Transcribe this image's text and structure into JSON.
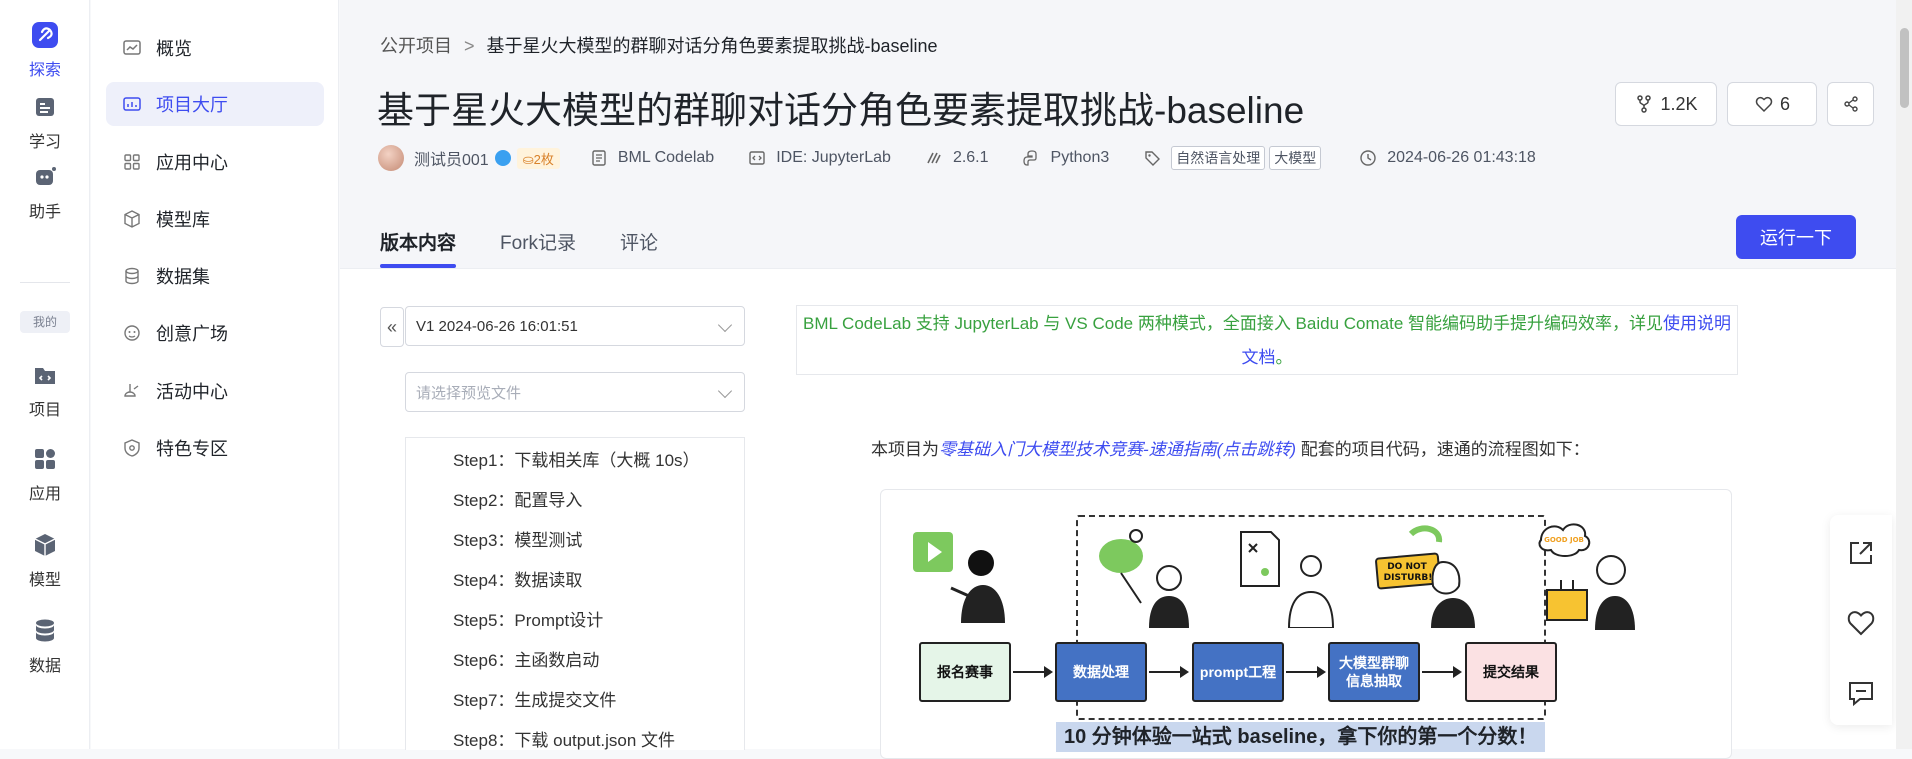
{
  "rail": {
    "items": [
      {
        "label": "探索",
        "icon": "explore-icon",
        "active": true
      },
      {
        "label": "学习",
        "icon": "learn-icon"
      },
      {
        "label": "助手",
        "icon": "assistant-icon"
      },
      {
        "label": "项目",
        "icon": "project-icon"
      },
      {
        "label": "应用",
        "icon": "app-icon"
      },
      {
        "label": "模型",
        "icon": "model-icon"
      },
      {
        "label": "数据",
        "icon": "data-icon"
      }
    ],
    "mine_label": "我的"
  },
  "sidebar": {
    "items": [
      {
        "label": "概览",
        "icon": "overview-icon"
      },
      {
        "label": "项目大厅",
        "icon": "project-hall-icon",
        "active": true
      },
      {
        "label": "应用中心",
        "icon": "app-center-icon"
      },
      {
        "label": "模型库",
        "icon": "model-library-icon"
      },
      {
        "label": "数据集",
        "icon": "dataset-icon"
      },
      {
        "label": "创意广场",
        "icon": "creative-icon"
      },
      {
        "label": "活动中心",
        "icon": "activity-icon"
      },
      {
        "label": "特色专区",
        "icon": "feature-icon"
      }
    ]
  },
  "breadcrumb": {
    "parent": "公开项目",
    "separator": ">",
    "current": "基于星火大模型的群聊对话分角色要素提取挑战-baseline"
  },
  "project": {
    "title": "基于星火大模型的群聊对话分角色要素提取挑战-baseline",
    "author": "测试员001",
    "coins": "2枚",
    "platform": "BML Codelab",
    "ide": "IDE: JupyterLab",
    "version": "2.6.1",
    "language": "Python3",
    "tags": [
      "自然语言处理",
      "大模型"
    ],
    "datetime": "2024-06-26 01:43:18"
  },
  "actions": {
    "fork_count": "1.2K",
    "like_count": "6"
  },
  "tabs": [
    {
      "label": "版本内容",
      "active": true
    },
    {
      "label": "Fork记录"
    },
    {
      "label": "评论"
    }
  ],
  "run_button": "运行一下",
  "version_select": "V1 2024-06-26 16:01:51",
  "preview_select_placeholder": "请选择预览文件",
  "toc": [
    "Step1：下载相关库（大概 10s）",
    "Step2：配置导入",
    "Step3：模型测试",
    "Step4：数据读取",
    "Step5：Prompt设计",
    "Step6：主函数启动",
    "Step7：生成提交文件",
    "Step8：下载 output.json 文件"
  ],
  "notice": {
    "text": "BML CodeLab 支持 JupyterLab 与 VS Code 两种模式，全面接入 Baidu Comate 智能编码助手提升编码效率，详见",
    "link1": "使用说明",
    "link2": "文档",
    "end": "。"
  },
  "intro": {
    "prefix": "本项目为",
    "link": "零基础入门大模型技术竞赛-速通指南(点击跳转)",
    "suffix": " 配套的项目代码，速通的流程图如下："
  },
  "flow": {
    "steps": [
      "报名赛事",
      "数据处理",
      "prompt工程",
      "大模型群聊信息抽取",
      "提交结果"
    ],
    "banner": "10 分钟体验一站式 baseline，拿下你的第一个分数！",
    "dnd_sign": "DO NOT DISTURB!",
    "good_job": "GOOD JOB"
  },
  "colors": {
    "accent": "#3e4cf0",
    "notice_green": "#38a13f",
    "flow_blue": "#4472c4",
    "flow_green": "#e5f5e8",
    "flow_pink": "#fbe1e3"
  }
}
